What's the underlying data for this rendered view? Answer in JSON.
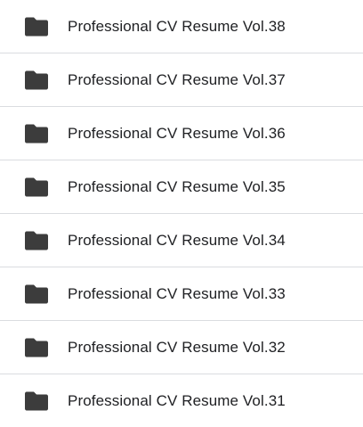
{
  "folder_list": {
    "icon": "folder-icon",
    "icon_color": "#3c3c3c",
    "items": [
      {
        "name": "Professional CV Resume Vol.38"
      },
      {
        "name": "Professional CV Resume Vol.37"
      },
      {
        "name": "Professional CV Resume Vol.36"
      },
      {
        "name": "Professional CV Resume Vol.35"
      },
      {
        "name": "Professional CV Resume Vol.34"
      },
      {
        "name": "Professional CV Resume Vol.33"
      },
      {
        "name": "Professional CV Resume Vol.32"
      },
      {
        "name": "Professional CV Resume Vol.31"
      }
    ]
  }
}
